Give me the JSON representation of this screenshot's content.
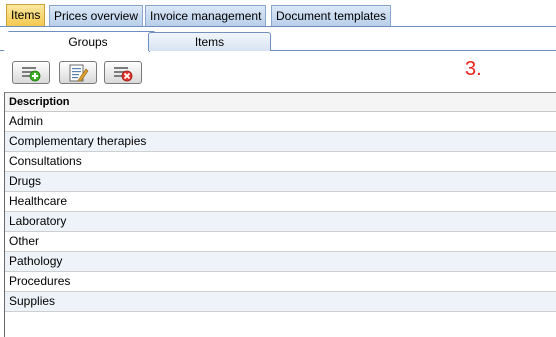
{
  "top_tabs": [
    {
      "label": "Items",
      "active": true
    },
    {
      "label": "Prices overview",
      "active": false
    },
    {
      "label": "Invoice management",
      "active": false
    },
    {
      "label": "Document templates",
      "active": false
    }
  ],
  "sub_tabs": {
    "groups": "Groups",
    "items": "Items"
  },
  "toolbar": {
    "add_icon": "add-icon",
    "edit_icon": "edit-icon",
    "delete_icon": "delete-icon"
  },
  "step_marker": "3.",
  "grid": {
    "header": "Description",
    "rows": [
      "Admin",
      "Complementary therapies",
      "Consultations",
      "Drugs",
      "Healthcare",
      "Laboratory",
      "Other",
      "Pathology",
      "Procedures",
      "Supplies"
    ]
  },
  "colors": {
    "active_tab": "#f3c74a",
    "tab": "#b9cfea",
    "step_marker": "#e8231c",
    "alt_row": "#eef3fa"
  }
}
